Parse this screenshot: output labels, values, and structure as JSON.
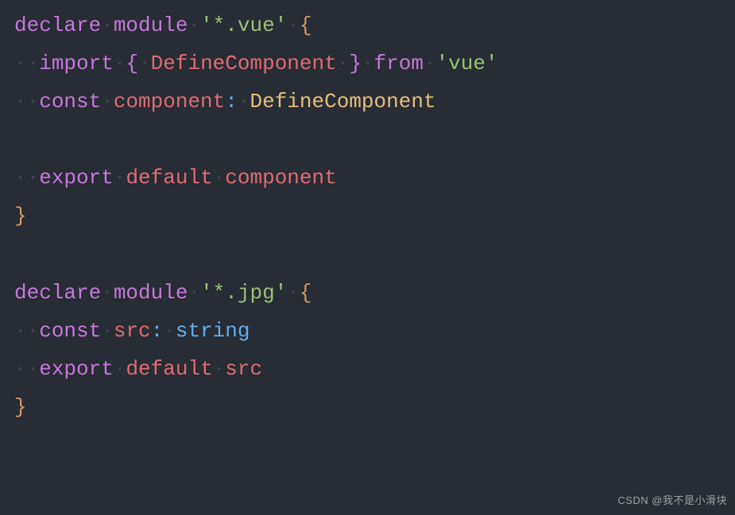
{
  "code": {
    "lines": [
      {
        "indent": 0,
        "tokens": [
          {
            "t": "declare",
            "c": "kw-purple"
          },
          {
            "t": "·",
            "c": "ws-dot"
          },
          {
            "t": "module",
            "c": "kw-purple"
          },
          {
            "t": "·",
            "c": "ws-dot"
          },
          {
            "t": "'*.vue'",
            "c": "str-green"
          },
          {
            "t": "·",
            "c": "ws-dot"
          },
          {
            "t": "{",
            "c": "brace-yellow"
          }
        ]
      },
      {
        "indent": 1,
        "tokens": [
          {
            "t": "·",
            "c": "ws-dot"
          },
          {
            "t": "·",
            "c": "ws-dot"
          },
          {
            "t": "import",
            "c": "kw-purple"
          },
          {
            "t": "·",
            "c": "ws-dot"
          },
          {
            "t": "{",
            "c": "brace-purple"
          },
          {
            "t": "·",
            "c": "ws-dot"
          },
          {
            "t": "DefineComponent",
            "c": "kw-red"
          },
          {
            "t": "·",
            "c": "ws-dot"
          },
          {
            "t": "}",
            "c": "brace-purple"
          },
          {
            "t": "·",
            "c": "ws-dot"
          },
          {
            "t": "from",
            "c": "kw-purple"
          },
          {
            "t": "·",
            "c": "ws-dot"
          },
          {
            "t": "'vue'",
            "c": "str-green"
          }
        ]
      },
      {
        "indent": 1,
        "tokens": [
          {
            "t": "·",
            "c": "ws-dot"
          },
          {
            "t": "·",
            "c": "ws-dot"
          },
          {
            "t": "const",
            "c": "kw-purple"
          },
          {
            "t": "·",
            "c": "ws-dot"
          },
          {
            "t": "component",
            "c": "kw-red"
          },
          {
            "t": ":",
            "c": "kw-blue"
          },
          {
            "t": "·",
            "c": "ws-dot"
          },
          {
            "t": "DefineComponent",
            "c": "type-yellow"
          }
        ]
      },
      {
        "indent": 1,
        "tokens": []
      },
      {
        "indent": 1,
        "tokens": [
          {
            "t": "·",
            "c": "ws-dot"
          },
          {
            "t": "·",
            "c": "ws-dot"
          },
          {
            "t": "export",
            "c": "kw-purple"
          },
          {
            "t": "·",
            "c": "ws-dot"
          },
          {
            "t": "default",
            "c": "kw-red"
          },
          {
            "t": "·",
            "c": "ws-dot"
          },
          {
            "t": "component",
            "c": "kw-red"
          }
        ]
      },
      {
        "indent": 0,
        "tokens": [
          {
            "t": "}",
            "c": "brace-yellow"
          }
        ]
      },
      {
        "indent": 0,
        "tokens": []
      },
      {
        "indent": 0,
        "tokens": [
          {
            "t": "declare",
            "c": "kw-purple"
          },
          {
            "t": "·",
            "c": "ws-dot"
          },
          {
            "t": "module",
            "c": "kw-purple"
          },
          {
            "t": "·",
            "c": "ws-dot"
          },
          {
            "t": "'*.jpg'",
            "c": "str-green"
          },
          {
            "t": "·",
            "c": "ws-dot"
          },
          {
            "t": "{",
            "c": "brace-yellow"
          }
        ]
      },
      {
        "indent": 1,
        "tokens": [
          {
            "t": "·",
            "c": "ws-dot"
          },
          {
            "t": "·",
            "c": "ws-dot"
          },
          {
            "t": "const",
            "c": "kw-purple"
          },
          {
            "t": "·",
            "c": "ws-dot"
          },
          {
            "t": "src",
            "c": "kw-red"
          },
          {
            "t": ":",
            "c": "kw-blue"
          },
          {
            "t": "·",
            "c": "ws-dot"
          },
          {
            "t": "string",
            "c": "kw-blue"
          }
        ]
      },
      {
        "indent": 1,
        "tokens": [
          {
            "t": "·",
            "c": "ws-dot"
          },
          {
            "t": "·",
            "c": "ws-dot"
          },
          {
            "t": "export",
            "c": "kw-purple"
          },
          {
            "t": "·",
            "c": "ws-dot"
          },
          {
            "t": "default",
            "c": "kw-red"
          },
          {
            "t": "·",
            "c": "ws-dot"
          },
          {
            "t": "src",
            "c": "kw-red"
          }
        ]
      },
      {
        "indent": 0,
        "tokens": [
          {
            "t": "}",
            "c": "brace-yellow"
          }
        ]
      }
    ]
  },
  "watermark": "CSDN @我不是小滑块"
}
